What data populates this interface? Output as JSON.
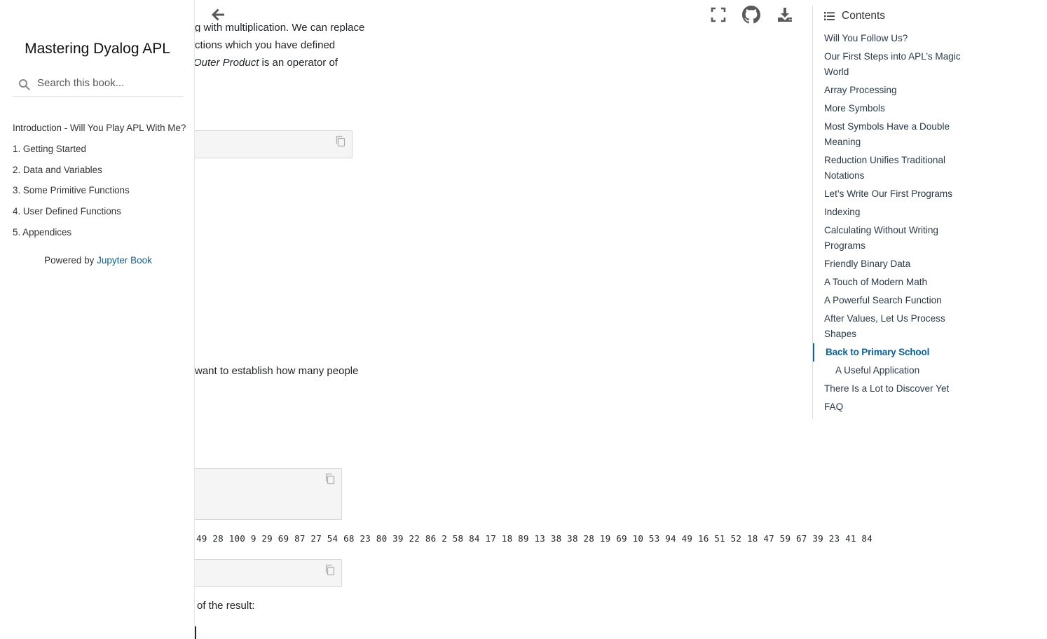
{
  "book": {
    "title": "Mastering Dyalog APL",
    "search_placeholder": "Search this book...",
    "powered_prefix": "Powered by ",
    "powered_link": "Jupyter Book"
  },
  "nav": [
    "Introduction - Will You Play APL With Me?",
    "1. Getting Started",
    "2. Data and Variables",
    "3. Some Primitive Functions",
    "4. User Defined Functions",
    "5. Appendices"
  ],
  "toc": {
    "heading": "Contents",
    "items": [
      "Will You Follow Us?",
      "Our First Steps into APL’s Magic World",
      "Array Processing",
      "More Symbols",
      "Most Symbols Have a Double Meaning",
      "Reduction Unifies Traditional Notations",
      "Let’s Write Our First Programs",
      "Indexing",
      "Calculating Without Writing Programs",
      "Friendly Binary Data",
      "A Touch of Modern Math",
      "A Powerful Search Function",
      "After Values, Let Us Process Shapes",
      "Back to Primary School",
      "A Useful Application",
      "There Is a Lot to Discover Yet",
      "FAQ"
    ],
    "active": "Back to Primary School",
    "sub": "A Useful Application"
  },
  "content": {
    "line1": "g with multiplication. We can replace",
    "line2": "ctions which you have defined",
    "line3_italic": "Outer Product",
    "line3_rest": " is an operator of",
    "para2": "want to establish how many people",
    "output": "49 28 100 9 29 69 87 27 54 68 23 80 39 22 86 2 58 84 17 18 89 13 38 38 28 19 69 10 53 94 49 16 51 52 18 47 59 67 39 23 41 84",
    "para3": "of the result:"
  },
  "icons": {
    "back": "arrow-left-icon",
    "fullscreen": "fullscreen-icon",
    "github": "github-icon",
    "download": "download-icon",
    "copy": "copy-icon",
    "search": "search-icon",
    "list": "list-icon"
  }
}
